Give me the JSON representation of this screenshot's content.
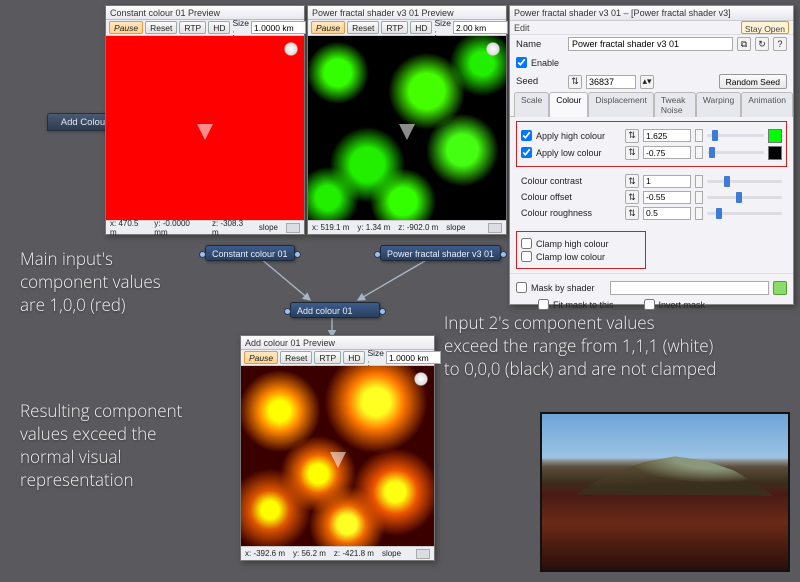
{
  "preview1": {
    "title": "Constant colour 01 Preview",
    "pause": "Pause",
    "reset": "Reset",
    "rtp": "RTP",
    "hd": "HD",
    "size_lbl": "Size :",
    "size": "1.0000 km",
    "status_x": "x: 470.5 m",
    "status_y": "y: -0.0000 mm",
    "status_z": "z: -308.3 m",
    "status_slope": "slope"
  },
  "preview2": {
    "title": "Power fractal shader v3 01 Preview",
    "pause": "Pause",
    "reset": "Reset",
    "rtp": "RTP",
    "hd": "HD",
    "size_lbl": "Size :",
    "size": "2.00 km",
    "status_x": "x: 519.1 m",
    "status_y": "y: 1.34 m",
    "status_z": "z: -902.0 m",
    "status_slope": "slope"
  },
  "preview3": {
    "title": "Add colour 01 Preview",
    "pause": "Pause",
    "reset": "Reset",
    "rtp": "RTP",
    "hd": "HD",
    "size_lbl": "Size :",
    "size": "1.0000 km",
    "status_x": "x: -392.6 m",
    "status_y": "y: 56.2 m",
    "status_z": "z: -421.8 m",
    "status_slope": "slope"
  },
  "nodes": {
    "side_tab": "Add Colour",
    "n1": "Constant colour 01",
    "n2": "Power fractal shader v3 01",
    "n3": "Add colour 01"
  },
  "panel": {
    "title": "Power fractal shader v3 01 – [Power fractal shader v3]",
    "edit": "Edit",
    "stay_open": "Stay Open",
    "name_lbl": "Name",
    "name_val": "Power fractal shader v3 01",
    "enable": "Enable",
    "seed_lbl": "Seed",
    "seed_val": "36837",
    "random_seed": "Random Seed",
    "tabs": {
      "scale": "Scale",
      "colour": "Colour",
      "displacement": "Displacement",
      "tweak": "Tweak Noise",
      "warp": "Warping",
      "anim": "Animation"
    },
    "apply_high": "Apply high colour",
    "apply_high_val": "1.625",
    "apply_low": "Apply low colour",
    "apply_low_val": "-0.75",
    "contrast_lbl": "Colour contrast",
    "contrast_val": "1",
    "offset_lbl": "Colour offset",
    "offset_val": "-0.55",
    "rough_lbl": "Colour roughness",
    "rough_val": "0.5",
    "clamp_high": "Clamp high colour",
    "clamp_low": "Clamp low colour",
    "mask_lbl": "Mask by shader",
    "fit_mask": "Fit mask to this",
    "invert_mask": "Invert mask"
  },
  "annot": {
    "a1": "Main input's\ncomponent values\nare 1,0,0 (red)",
    "a2": "Input 2's component values\nexceed the range from 1,1,1 (white)\nto 0,0,0 (black) and are not clamped",
    "a3": "Resulting component\nvalues exceed the\nnormal visual\nrepresentation"
  }
}
